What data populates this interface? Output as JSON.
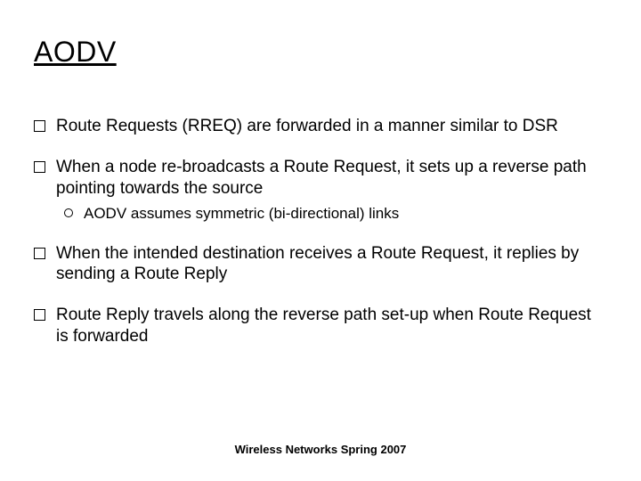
{
  "title": "AODV",
  "bullets": {
    "b1": "Route Requests (RREQ) are forwarded in a manner similar to DSR",
    "b2": "When a node re-broadcasts a Route Request, it sets up a reverse path pointing towards the source",
    "b2_sub1": "AODV assumes symmetric (bi-directional) links",
    "b3": "When the intended destination receives a Route Request, it replies by sending a Route Reply",
    "b4": "Route Reply travels along the reverse path set-up when Route Request is forwarded"
  },
  "footer": "Wireless Networks Spring 2007"
}
